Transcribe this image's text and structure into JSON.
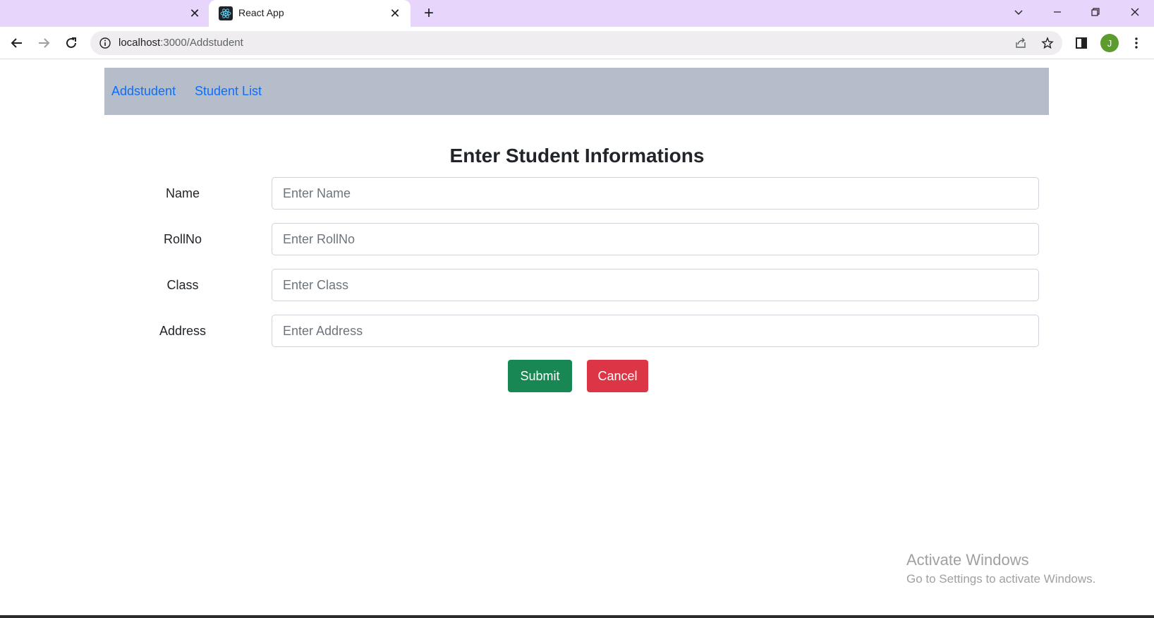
{
  "browser": {
    "inactive_tab": {
      "close_glyph": "✕"
    },
    "active_tab": {
      "title": "React App",
      "close_glyph": "✕"
    },
    "new_tab_glyph": "+",
    "address": {
      "host": "localhost",
      "path": ":3000/Addstudent"
    },
    "profile_initial": "J",
    "profile_color": "#5d9b2e"
  },
  "navbar": {
    "links": [
      {
        "label": "Addstudent"
      },
      {
        "label": "Student List"
      }
    ],
    "background": "#b4bdc9",
    "link_color": "#0d6efd"
  },
  "form": {
    "title": "Enter Student Informations",
    "fields": [
      {
        "label": "Name",
        "placeholder": "Enter Name",
        "value": ""
      },
      {
        "label": "RollNo",
        "placeholder": "Enter RollNo",
        "value": ""
      },
      {
        "label": "Class",
        "placeholder": "Enter Class",
        "value": ""
      },
      {
        "label": "Address",
        "placeholder": "Enter Address",
        "value": ""
      }
    ],
    "submit_label": "Submit",
    "cancel_label": "Cancel",
    "submit_color": "#198754",
    "cancel_color": "#dc3545"
  },
  "watermark": {
    "title": "Activate Windows",
    "subtitle": "Go to Settings to activate Windows."
  }
}
